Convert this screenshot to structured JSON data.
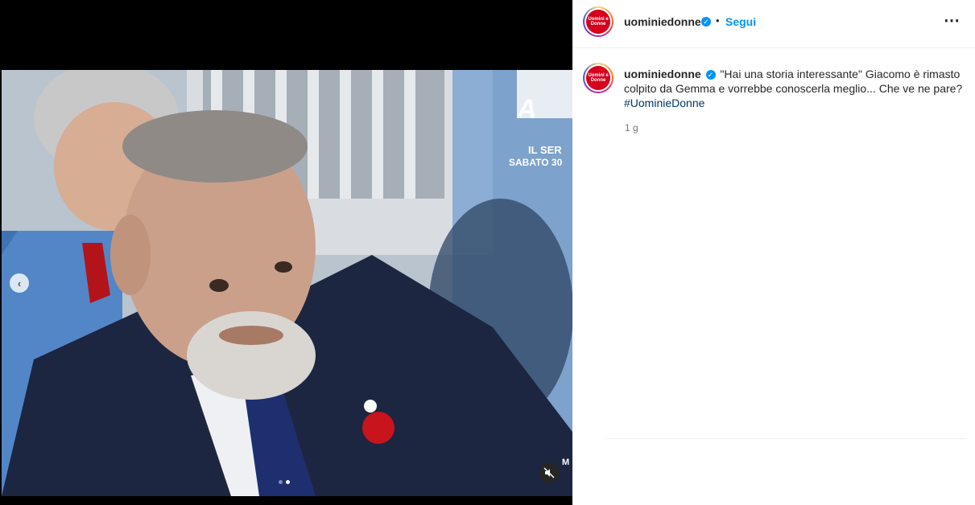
{
  "post": {
    "account": "uominiedonne",
    "logo_text": "Uomini e Donne",
    "dot": "•",
    "follow_label": "Segui",
    "more_icon": "⋯",
    "caption_text": "\"Hai una storia interessante\" Giacomo è rimasto colpito da Gemma e vorrebbe conoscerla meglio... Che ve ne pare?",
    "hashtag": "#UominieDonne",
    "time": "1 g"
  },
  "media": {
    "overlay_line1": "IL SER",
    "overlay_line2": "SABATO 30",
    "overlay_corner": "M",
    "carousel_total": 2,
    "carousel_active": 2
  },
  "colors": {
    "accent": "#0095f6",
    "hashtag": "#00376b",
    "brand_red": "#d6001c"
  }
}
